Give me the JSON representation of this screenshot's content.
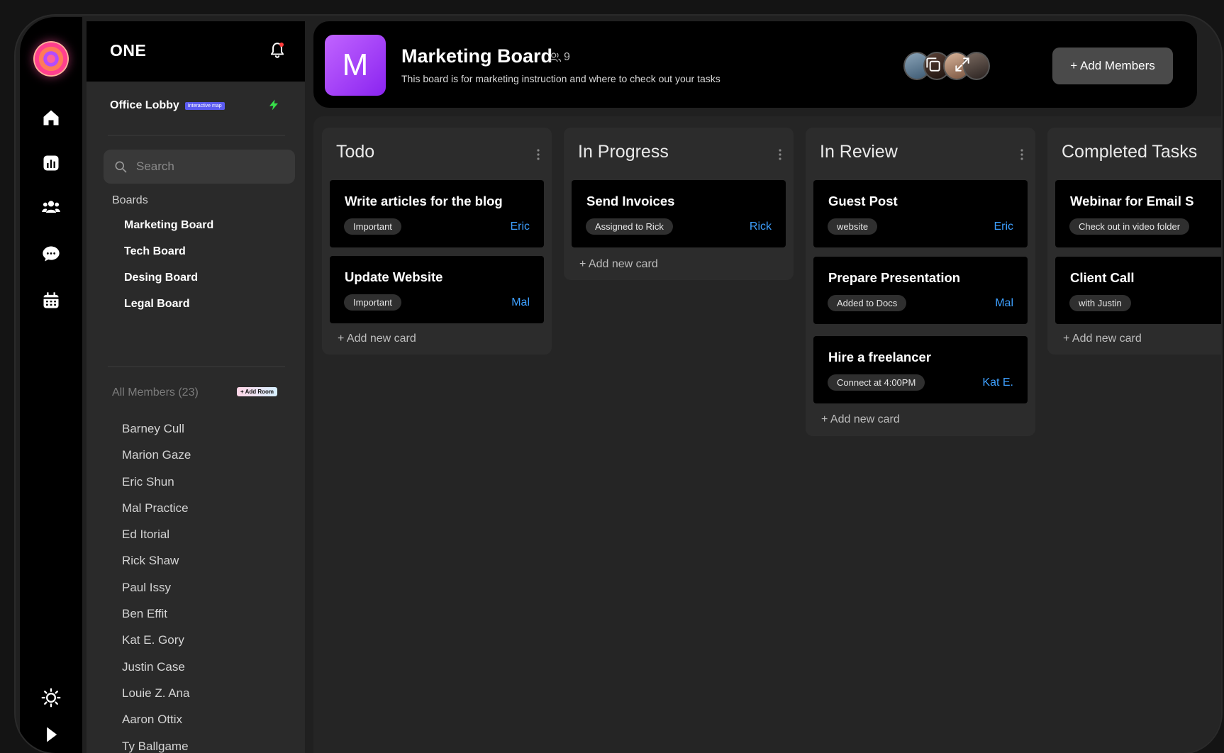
{
  "app": {
    "name": "ONE"
  },
  "lobby": {
    "title": "Office Lobby",
    "badge": "Interactive map"
  },
  "search": {
    "placeholder": "Search"
  },
  "boards": {
    "label": "Boards",
    "items": [
      "Marketing Board",
      "Tech Board",
      "Desing Board",
      "Legal Board"
    ]
  },
  "members": {
    "label": "All Members (23)",
    "add_room": "+ Add Room",
    "items": [
      "Barney Cull",
      "Marion Gaze",
      "Eric Shun",
      "Mal Practice",
      "Ed Itorial",
      "Rick Shaw",
      "Paul Issy",
      "Ben Effit",
      "Kat E. Gory",
      "Justin Case",
      "Louie Z. Ana",
      "Aaron Ottix",
      "Ty Ballgame"
    ]
  },
  "header": {
    "avatar_letter": "M",
    "title": "Marketing Board",
    "member_count": "9",
    "description": "This board is for marketing instruction and where to check out your tasks",
    "add_members_label": "+ Add Members"
  },
  "columns": [
    {
      "title": "Todo",
      "add_label": "+ Add new card",
      "cards": [
        {
          "title": "Write articles for the blog",
          "tag": "Important",
          "assignee": "Eric"
        },
        {
          "title": "Update Website",
          "tag": "Important",
          "assignee": "Mal"
        }
      ]
    },
    {
      "title": "In Progress",
      "add_label": "+ Add new card",
      "cards": [
        {
          "title": "Send Invoices",
          "tag": "Assigned to Rick",
          "assignee": "Rick"
        }
      ]
    },
    {
      "title": "In Review",
      "add_label": "+ Add new card",
      "cards": [
        {
          "title": "Guest Post",
          "tag": "website",
          "assignee": "Eric"
        },
        {
          "title": "Prepare Presentation",
          "tag": "Added to Docs",
          "assignee": "Mal"
        },
        {
          "title": "Hire a freelancer",
          "tag": "Connect at 4:00PM",
          "assignee": "Kat E."
        }
      ]
    },
    {
      "title": "Completed Tasks",
      "add_label": "+ Add new card",
      "cards": [
        {
          "title": "Webinar for Email S",
          "tag": "Check out in video folder",
          "assignee": ""
        },
        {
          "title": "Client Call",
          "tag": "with Justin",
          "assignee": ""
        }
      ]
    }
  ],
  "colors": {
    "accent_blue": "#3ea0ff",
    "board_purple": "#a23ff5",
    "bolt_green": "#38e04a"
  }
}
